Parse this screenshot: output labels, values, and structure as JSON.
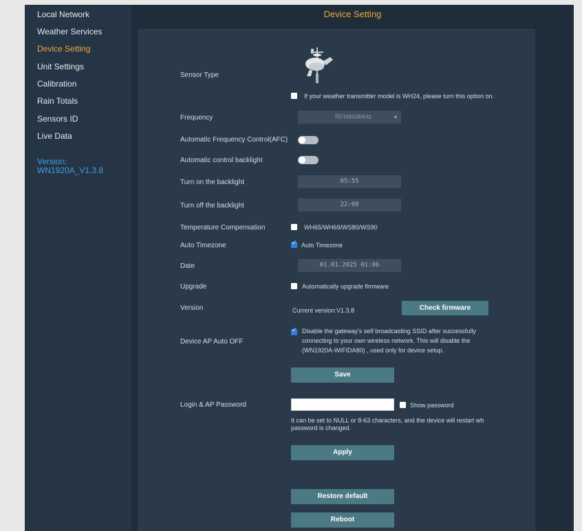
{
  "sidebar": {
    "items": [
      {
        "label": "Local Network",
        "active": false
      },
      {
        "label": "Weather Services",
        "active": false
      },
      {
        "label": "Device Setting",
        "active": true
      },
      {
        "label": "Unit Settings",
        "active": false
      },
      {
        "label": "Calibration",
        "active": false
      },
      {
        "label": "Rain Totals",
        "active": false
      },
      {
        "label": "Sensors ID",
        "active": false
      },
      {
        "label": "Live Data",
        "active": false
      }
    ],
    "version_label": "Version:",
    "version_value": "WN1920A_V1.3.8"
  },
  "page": {
    "title": "Device Setting"
  },
  "colors": {
    "accent": "#e9a83b",
    "link": "#3ea0e0",
    "button": "#4b7a84",
    "checkbox_checked": "#2f7fe0"
  },
  "form": {
    "sensor_type": {
      "label": "Sensor Type",
      "icon": "weather-station-icon",
      "wh24_text": "If your weather transmitter model is WH24, please turn this option on.",
      "wh24_checked": false
    },
    "frequency": {
      "label": "Frequency",
      "value": "RFM868MHz"
    },
    "afc": {
      "label": "Automatic Frequency Control(AFC)",
      "on": false
    },
    "auto_backlight": {
      "label": "Automatic control backlight",
      "on": false
    },
    "backlight_on": {
      "label": "Turn on the backlight",
      "value": "05:55"
    },
    "backlight_off": {
      "label": "Turn off the backlight",
      "value": "22:00"
    },
    "temp_comp": {
      "label": "Temperature Compensation",
      "option": "WH65/WH69/WS80/WS90",
      "checked": false
    },
    "auto_timezone": {
      "label": "Auto Timezone",
      "option": "Auto Timezone",
      "checked": true
    },
    "date": {
      "label": "Date",
      "value": "01.01.2025 01:06"
    },
    "upgrade": {
      "label": "Upgrade",
      "option": "Automatically upgrade firmware",
      "checked": false
    },
    "version": {
      "label": "Version",
      "current": "Current version:V1.3.8",
      "check_button": "Check firmware"
    },
    "ap_auto_off": {
      "label": "Device AP Auto OFF",
      "checked": true,
      "text_line1": "Disable the gateway's self broadcasting SSID after successfully",
      "text_line2": "connecting to your own wireless network. This will disable the",
      "text_line3": "(WN1920A-WIFIDA80) , used only for device setup."
    },
    "save_button": "Save",
    "password": {
      "label": "Login & AP Password",
      "value": "",
      "show_label": "Show password",
      "show_checked": false,
      "note_line1": "It can be set to NULL or 8-63 characters, and the device will restart wh",
      "note_line2": "password is changed."
    },
    "apply_button": "Apply",
    "restore_button": "Restore default",
    "reboot_button": "Reboot"
  }
}
